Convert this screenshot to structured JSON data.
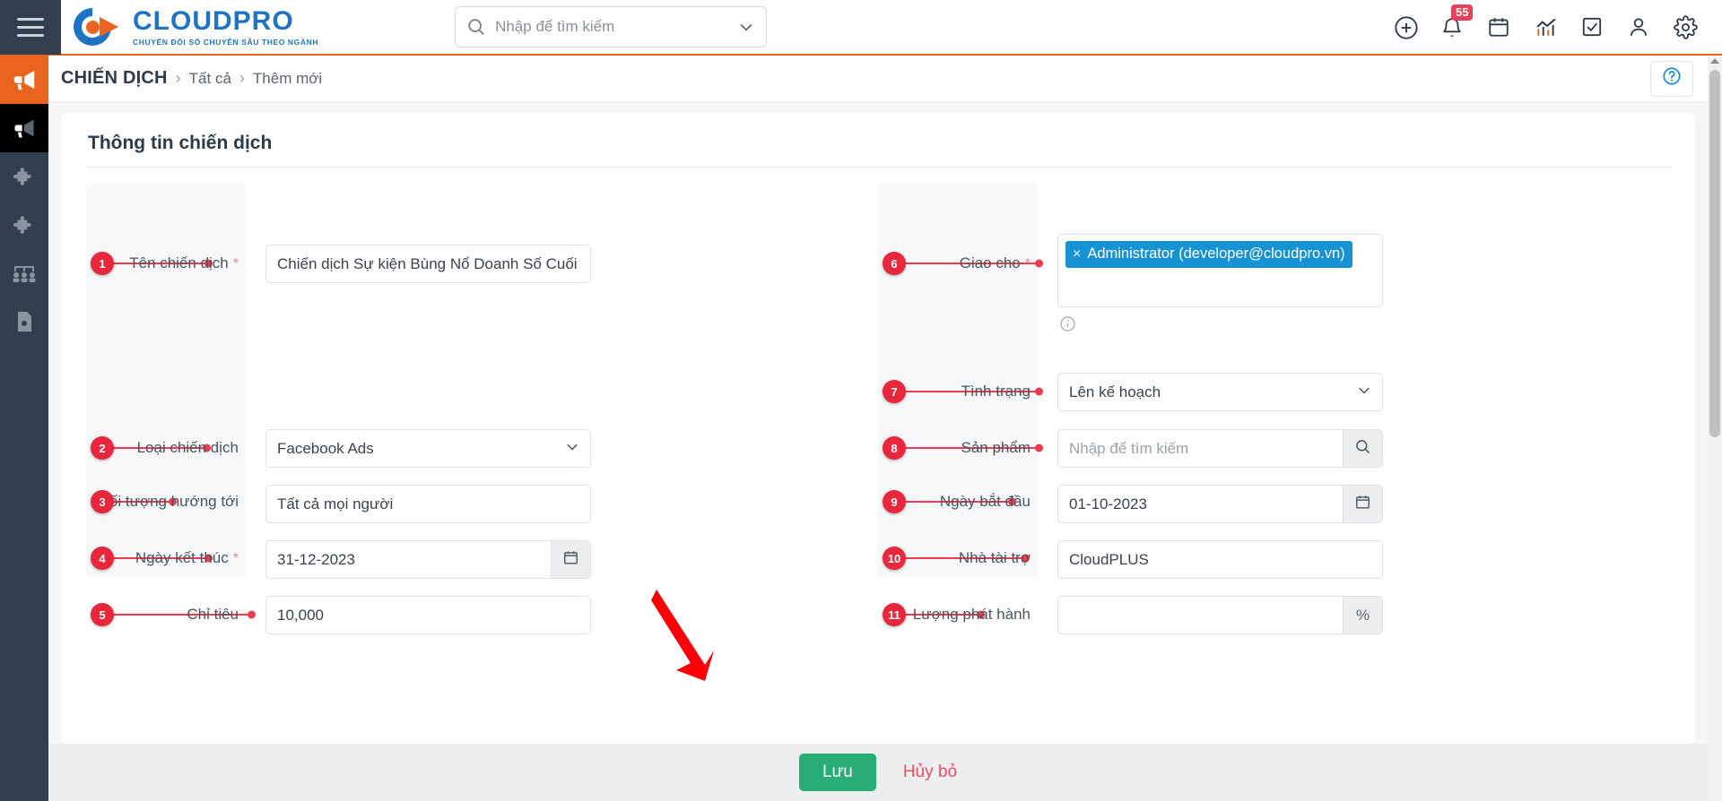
{
  "topbar": {
    "menu_icon": "hamburger-icon",
    "logo_name": "CLOUDPRO",
    "logo_tagline": "CHUYỂN ĐỔI SỐ CHUYÊN SÂU THEO NGÀNH",
    "search_placeholder": "Nhập để tìm kiếm",
    "search_value": "",
    "icons": [
      {
        "name": "add-icon",
        "label": "Thêm"
      },
      {
        "name": "bell-icon",
        "label": "Thông báo",
        "badge": "55"
      },
      {
        "name": "calendar-icon",
        "label": "Lịch"
      },
      {
        "name": "analytics-icon",
        "label": "Báo cáo"
      },
      {
        "name": "task-icon",
        "label": "Công việc"
      },
      {
        "name": "user-icon",
        "label": "Tài khoản"
      },
      {
        "name": "gear-icon",
        "label": "Cài đặt"
      }
    ]
  },
  "sidebar": {
    "items": [
      {
        "name": "sidebar-item-campaign",
        "icon": "megaphone-icon",
        "state": "active-orange"
      },
      {
        "name": "sidebar-item-campaign-sub",
        "icon": "megaphone-icon",
        "state": "active-dark"
      },
      {
        "name": "sidebar-item-module-1",
        "icon": "puzzle-icon",
        "state": ""
      },
      {
        "name": "sidebar-item-module-2",
        "icon": "puzzle-icon",
        "state": ""
      },
      {
        "name": "sidebar-item-team",
        "icon": "team-icon",
        "state": ""
      },
      {
        "name": "sidebar-item-document",
        "icon": "document-icon",
        "state": ""
      }
    ]
  },
  "breadcrumb": {
    "title": "CHIẾN DỊCH",
    "sep": "›",
    "item1": "Tất cả",
    "item2": "Thêm mới",
    "help_icon": "question-circle-icon"
  },
  "form": {
    "card_title": "Thông tin chiến dịch",
    "left": [
      {
        "num": "1",
        "label": "Tên chiến dịch",
        "required": true,
        "value": "Chiến dịch Sự kiện Bùng Nổ Doanh Số Cuối",
        "placeholder": "",
        "control": "text"
      },
      {
        "num": "2",
        "label": "Loại chiến dịch",
        "required": false,
        "value": "Facebook Ads",
        "placeholder": "",
        "control": "select"
      },
      {
        "num": "3",
        "label": "Đối tượng hướng tới",
        "required": false,
        "value": "Tất cả mọi người",
        "placeholder": "",
        "control": "text"
      },
      {
        "num": "4",
        "label": "Ngày kết thúc",
        "required": true,
        "value": "31-12-2023",
        "placeholder": "",
        "control": "date"
      },
      {
        "num": "5",
        "label": "Chỉ tiêu",
        "required": false,
        "value": "10,000",
        "placeholder": "",
        "control": "text"
      }
    ],
    "right": [
      {
        "num": "6",
        "label": "Giao cho",
        "required": true,
        "value": "",
        "placeholder": "",
        "control": "tags",
        "tag_text": "Administrator (developer@cloudpro.vn)",
        "tag_remove": "×",
        "tag_color": "#1593d3",
        "info_icon": "info-circle-icon"
      },
      {
        "num": "7",
        "label": "Tình trạng",
        "required": false,
        "value": "Lên kế hoạch",
        "placeholder": "",
        "control": "select"
      },
      {
        "num": "8",
        "label": "Sản phẩm",
        "required": false,
        "value": "",
        "placeholder": "Nhập để tìm kiếm",
        "control": "search"
      },
      {
        "num": "9",
        "label": "Ngày bắt đầu",
        "required": false,
        "value": "01-10-2023",
        "placeholder": "",
        "control": "date"
      },
      {
        "num": "10",
        "label": "Nhà tài trợ",
        "required": false,
        "value": "CloudPLUS",
        "placeholder": "",
        "control": "text"
      },
      {
        "num": "11",
        "label": "Lượng phát hành",
        "required": false,
        "value": "",
        "placeholder": "",
        "control": "percent",
        "suffix": "%"
      }
    ]
  },
  "footer": {
    "save_label": "Lưu",
    "cancel_label": "Hủy bỏ",
    "save_color": "#27ae77",
    "cancel_color": "#ef4f61",
    "pointer_annotation": "red-arrow-pointing-to-save"
  }
}
